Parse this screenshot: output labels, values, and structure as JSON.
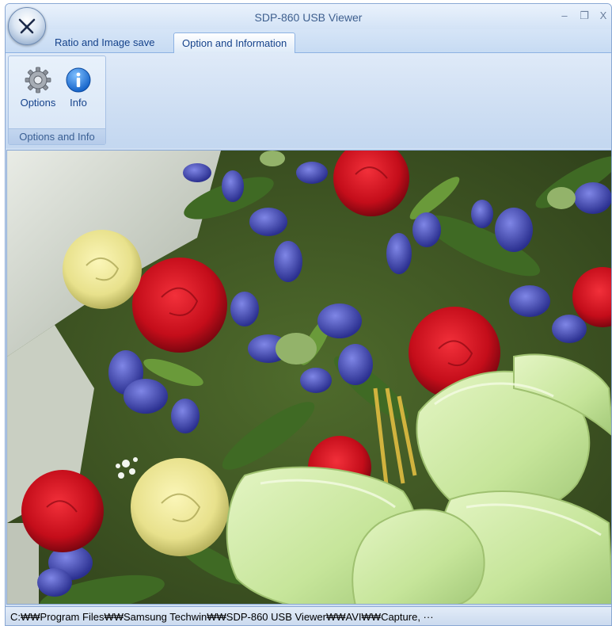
{
  "app": {
    "title": "SDP-860 USB Viewer"
  },
  "window_controls": {
    "minimize": "–",
    "restore": "❐",
    "close": "X"
  },
  "tabs": [
    {
      "label": "Ratio and Image save"
    },
    {
      "label": "Option and Information",
      "active": true
    }
  ],
  "ribbon": {
    "group_caption": "Options and Info",
    "buttons": [
      {
        "label": "Options",
        "icon": "gear-icon"
      },
      {
        "label": "Info",
        "icon": "info-icon"
      }
    ]
  },
  "viewer": {
    "content": "camera capture image"
  },
  "status": {
    "path": "C:₩₩Program Files₩₩Samsung Techwin₩₩SDP-860 USB Viewer₩₩AVI₩₩Capture, ···"
  },
  "colors": {
    "ribbon_blue": "#cfdff2",
    "accent_text": "#15428b"
  }
}
